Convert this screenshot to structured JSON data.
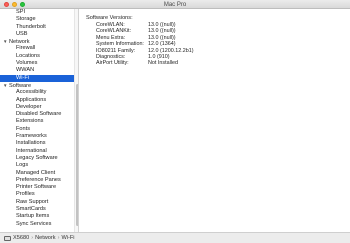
{
  "window": {
    "title": "Mac Pro"
  },
  "sidebar": {
    "network_top_items": [
      "SPI",
      "Storage",
      "Thunderbolt",
      "USB"
    ],
    "network": {
      "label": "Network",
      "items": [
        "Firewall",
        "Locations",
        "Volumes",
        "WWAN",
        "Wi-Fi"
      ],
      "selected": "Wi-Fi"
    },
    "software": {
      "label": "Software",
      "items": [
        "Accessibility",
        "Applications",
        "Developer",
        "Disabled Software",
        "Extensions",
        "Fonts",
        "Frameworks",
        "Installations",
        "International",
        "Legacy Software",
        "Logs",
        "Managed Client",
        "Preference Panes",
        "Printer Software",
        "Profiles",
        "Raw Support",
        "SmartCards",
        "Startup Items",
        "Sync Services"
      ]
    }
  },
  "content": {
    "section_title": "Software Versions:",
    "rows": [
      {
        "key": "CoreWLAN:",
        "value": "13.0 ((null))"
      },
      {
        "key": "CoreWLANKit:",
        "value": "13.0 ((null))"
      },
      {
        "key": "Menu Extra:",
        "value": "13.0 ((null))"
      },
      {
        "key": "System Information:",
        "value": "12.0 (1364)"
      },
      {
        "key": "IO80211 Family:",
        "value": "12.0 (1200.12.2b1)"
      },
      {
        "key": "Diagnostics:",
        "value": "1.0 (910)"
      },
      {
        "key": "AirPort Utility:",
        "value": "Not Installed"
      }
    ]
  },
  "pathbar": {
    "segments": [
      "X5680",
      "Network",
      "Wi-Fi"
    ],
    "separator": "›"
  },
  "colors": {
    "selection": "#1a62d8",
    "close": "#fd5f57",
    "minimize": "#febb2e",
    "zoom": "#28c840"
  }
}
